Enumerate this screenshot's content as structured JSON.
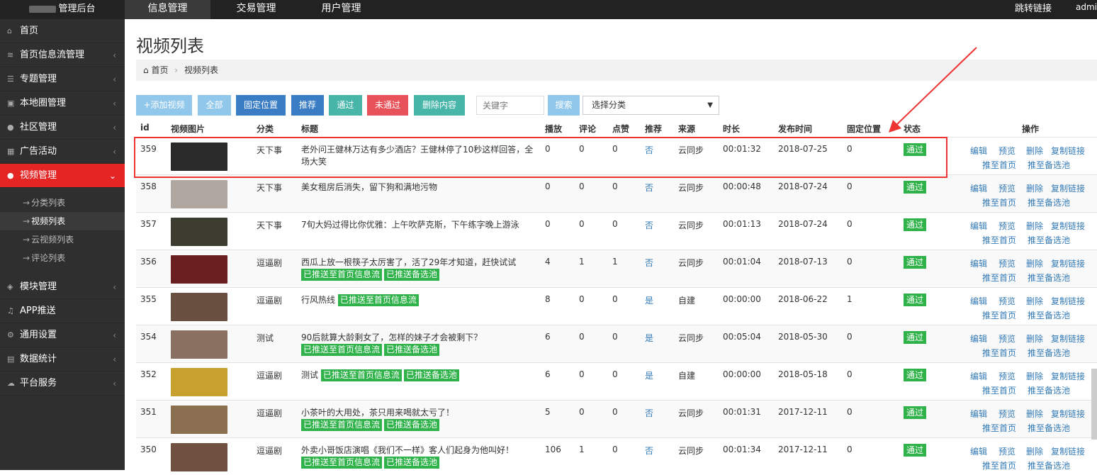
{
  "topbar": {
    "app_title": "管理后台",
    "nav": [
      "信息管理",
      "交易管理",
      "用户管理"
    ],
    "jump_link": "跳转链接",
    "user": "admin"
  },
  "sidebar": {
    "items": [
      {
        "label": "首页",
        "icon": "home-icon"
      },
      {
        "label": "首页信息流管理",
        "icon": "rss-icon"
      },
      {
        "label": "专题管理",
        "icon": "list-icon"
      },
      {
        "label": "本地圈管理",
        "icon": "image-icon"
      },
      {
        "label": "社区管理",
        "icon": "users-icon"
      },
      {
        "label": "广告活动",
        "icon": "calendar-icon"
      },
      {
        "label": "视频管理",
        "icon": "users-icon"
      }
    ],
    "sub_items": [
      "分类列表",
      "视频列表",
      "云视频列表",
      "评论列表"
    ],
    "items_after": [
      {
        "label": "模块管理",
        "icon": "cubes-icon"
      },
      {
        "label": "APP推送",
        "icon": "bell-icon"
      },
      {
        "label": "通用设置",
        "icon": "cogs-icon"
      },
      {
        "label": "数据统计",
        "icon": "chart-icon"
      },
      {
        "label": "平台服务",
        "icon": "cloud-icon"
      }
    ]
  },
  "main": {
    "title": "视频列表",
    "breadcrumb": {
      "home": "首页",
      "current": "视频列表"
    },
    "toolbar": {
      "add": "+添加视频",
      "all": "全部",
      "fixed": "固定位置",
      "recommend": "推荐",
      "pass": "通过",
      "not_pass": "未通过",
      "delete_content": "删除内容",
      "search_placeholder": "关键字",
      "search": "搜索",
      "category_select": "选择分类"
    },
    "columns": [
      "id",
      "视频图片",
      "分类",
      "标题",
      "播放",
      "评论",
      "点赞",
      "推荐",
      "来源",
      "时长",
      "发布时间",
      "固定位置",
      "状态",
      "操作"
    ],
    "rows": [
      {
        "id": "359",
        "category": "天下事",
        "title": "老外问王健林万达有多少酒店？王健林停了10秒这样回答，全场大笑",
        "tags": [],
        "plays": "0",
        "comments": "0",
        "likes": "0",
        "recommend": "否",
        "source": "云同步",
        "duration": "00:01:32",
        "date": "2018-07-25",
        "fixed": "0",
        "status": "通过",
        "thumb": "#2a2a2a"
      },
      {
        "id": "358",
        "category": "天下事",
        "title": "美女租房后消失，留下狗和满地污物",
        "tags": [],
        "plays": "0",
        "comments": "0",
        "likes": "0",
        "recommend": "否",
        "source": "云同步",
        "duration": "00:00:48",
        "date": "2018-07-24",
        "fixed": "0",
        "status": "通过",
        "thumb": "#b0a8a0"
      },
      {
        "id": "357",
        "category": "天下事",
        "title": "7旬大妈过得比你优雅：上午吹萨克斯，下午练字晚上游泳",
        "tags": [],
        "plays": "0",
        "comments": "0",
        "likes": "0",
        "recommend": "否",
        "source": "云同步",
        "duration": "00:01:13",
        "date": "2018-07-24",
        "fixed": "0",
        "status": "通过",
        "thumb": "#3c3c30"
      },
      {
        "id": "356",
        "category": "逗逼剧",
        "title": "西瓜上放一根筷子太厉害了，活了29年才知道，赶快试试",
        "tags": [
          "已推送至首页信息流",
          "已推送备选池"
        ],
        "plays": "4",
        "comments": "1",
        "likes": "1",
        "recommend": "否",
        "source": "云同步",
        "duration": "00:01:04",
        "date": "2018-07-13",
        "fixed": "0",
        "status": "通过",
        "thumb": "#6a2020"
      },
      {
        "id": "355",
        "category": "逗逼剧",
        "title": "行风热线",
        "tags": [
          "已推送至首页信息流"
        ],
        "plays": "8",
        "comments": "0",
        "likes": "0",
        "recommend": "是",
        "source": "自建",
        "duration": "00:00:00",
        "date": "2018-06-22",
        "fixed": "1",
        "status": "通过",
        "thumb": "#6a5040"
      },
      {
        "id": "354",
        "category": "测试",
        "title": "90后就算大龄剩女了，怎样的妹子才会被剩下？",
        "tags": [
          "已推送至首页信息流",
          "已推送备选池"
        ],
        "plays": "6",
        "comments": "0",
        "likes": "0",
        "recommend": "是",
        "source": "云同步",
        "duration": "00:05:04",
        "date": "2018-05-30",
        "fixed": "0",
        "status": "通过",
        "thumb": "#8a7060"
      },
      {
        "id": "352",
        "category": "逗逼剧",
        "title": "测试",
        "tags": [
          "已推送至首页信息流",
          "已推送备选池"
        ],
        "plays": "6",
        "comments": "0",
        "likes": "0",
        "recommend": "是",
        "source": "自建",
        "duration": "00:00:00",
        "date": "2018-05-18",
        "fixed": "0",
        "status": "通过",
        "thumb": "#c8a030"
      },
      {
        "id": "351",
        "category": "逗逼剧",
        "title": "小茶叶的大用处，茶只用来喝就太亏了！",
        "tags": [
          "已推送至首页信息流",
          "已推送备选池"
        ],
        "plays": "5",
        "comments": "0",
        "likes": "0",
        "recommend": "否",
        "source": "云同步",
        "duration": "00:01:31",
        "date": "2017-12-11",
        "fixed": "0",
        "status": "通过",
        "thumb": "#8a7050"
      },
      {
        "id": "350",
        "category": "逗逼剧",
        "title": "外卖小哥饭店演唱《我们不一样》客人们起身为他叫好！",
        "tags": [
          "已推送至首页信息流",
          "已推送备选池"
        ],
        "plays": "106",
        "comments": "1",
        "likes": "0",
        "recommend": "否",
        "source": "云同步",
        "duration": "00:01:34",
        "date": "2017-12-11",
        "fixed": "0",
        "status": "通过",
        "thumb": "#705040"
      }
    ],
    "ops": {
      "edit": "编辑",
      "preview": "预览",
      "delete": "删除",
      "copy_link": "复制链接",
      "push_home": "推至首页",
      "push_pool": "推至备选池"
    }
  },
  "colors": {
    "accent_red": "#e52424",
    "green": "#2fb24a",
    "blue_link": "#337ab7",
    "sidebar_bg": "#2f2f2f",
    "topbar_bg": "#222222"
  }
}
